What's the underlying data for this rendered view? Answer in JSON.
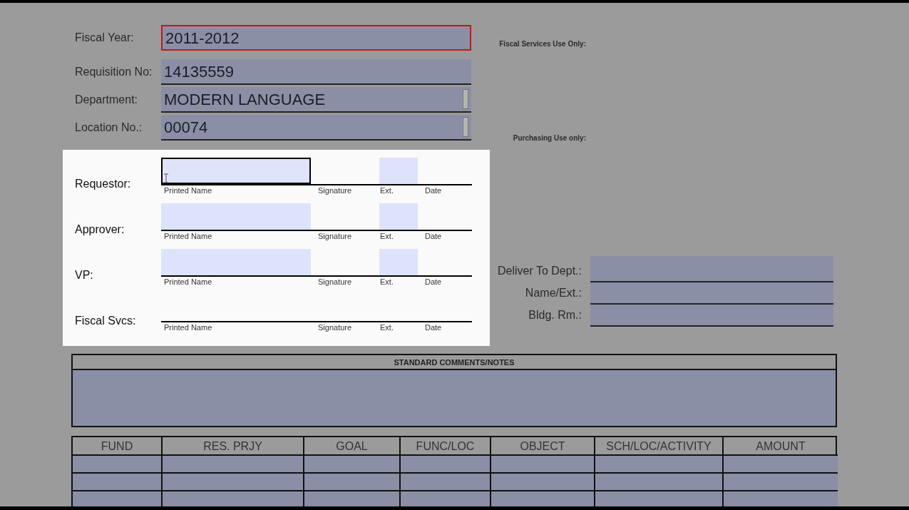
{
  "header_fields": [
    {
      "label": "Fiscal Year:",
      "value": "2011-2012",
      "focused": true,
      "dropdown": false
    },
    {
      "label": "Requisition No:",
      "value": "14135559",
      "focused": false,
      "dropdown": false
    },
    {
      "label": "Department:",
      "value": "MODERN LANGUAGE",
      "focused": false,
      "dropdown": true
    },
    {
      "label": "Location No.:",
      "value": "00074",
      "focused": false,
      "dropdown": true
    }
  ],
  "fiscal_services_note": "Fiscal Services Use Only:",
  "purchasing_note": "Purchasing Use only:",
  "signatures": [
    {
      "label": "Requestor:",
      "fillable": true,
      "focused": true,
      "captions": [
        "Printed Name",
        "Signature",
        "Ext.",
        "Date"
      ]
    },
    {
      "label": "Approver:",
      "fillable": true,
      "focused": false,
      "captions": [
        "Printed Name",
        "Signature",
        "Ext.",
        "Date"
      ]
    },
    {
      "label": "VP:",
      "fillable": true,
      "focused": false,
      "captions": [
        "Printed Name",
        "Signature",
        "Ext.",
        "Date"
      ]
    },
    {
      "label": "Fiscal Svcs:",
      "fillable": false,
      "focused": false,
      "captions": [
        "Printed Name",
        "Signature",
        "Ext.",
        "Date"
      ]
    }
  ],
  "delivery": [
    {
      "label": "Deliver To Dept.:"
    },
    {
      "label": "Name/Ext.:"
    },
    {
      "label": "Bldg. Rm.:"
    }
  ],
  "comments": {
    "title": "STANDARD COMMENTS/NOTES"
  },
  "table": {
    "columns": [
      "FUND",
      "RES. PRJY",
      "GOAL",
      "FUNC/LOC",
      "OBJECT",
      "SCH/LOC/ACTIVITY",
      "AMOUNT"
    ]
  }
}
